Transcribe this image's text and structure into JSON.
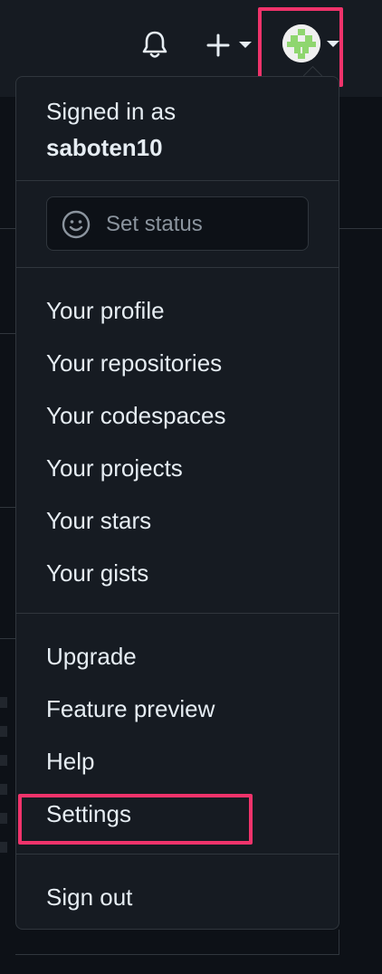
{
  "header": {
    "notifications_icon": "bell-icon",
    "create_icon": "plus-icon",
    "avatar_colors": {
      "background": "#f0f0f0",
      "pattern": "#8fd66f"
    }
  },
  "menu": {
    "signed_in_label": "Signed in as",
    "username": "saboten10",
    "set_status_label": "Set status",
    "set_status_icon": "smiley-icon",
    "profile_items": [
      "Your profile",
      "Your repositories",
      "Your codespaces",
      "Your projects",
      "Your stars",
      "Your gists"
    ],
    "misc_items": [
      "Upgrade",
      "Feature preview",
      "Help",
      "Settings"
    ],
    "sign_out_label": "Sign out"
  },
  "colors": {
    "highlight": "#f0336b",
    "menu_background": "#161b22",
    "text": "#e6edf3",
    "muted_text": "#8b949e"
  }
}
